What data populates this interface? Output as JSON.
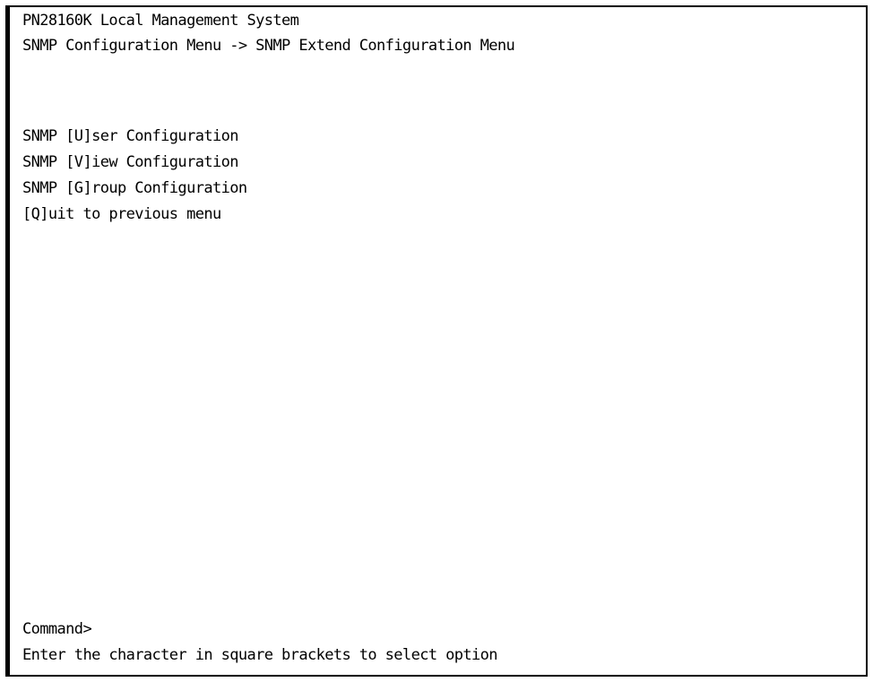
{
  "header": {
    "system_title": "PN28160K Local Management System",
    "breadcrumb": "SNMP Configuration Menu -> SNMP Extend Configuration Menu"
  },
  "menu": {
    "options": [
      {
        "key": "U",
        "label": "SNMP [U]ser Configuration"
      },
      {
        "key": "V",
        "label": "SNMP [V]iew Configuration"
      },
      {
        "key": "G",
        "label": "SNMP [G]roup Configuration"
      },
      {
        "key": "Q",
        "label": "[Q]uit to previous menu"
      }
    ]
  },
  "command": {
    "prompt": "Command>",
    "input_value": ""
  },
  "footer": {
    "help_text": "Enter the character in square brackets to select option"
  }
}
